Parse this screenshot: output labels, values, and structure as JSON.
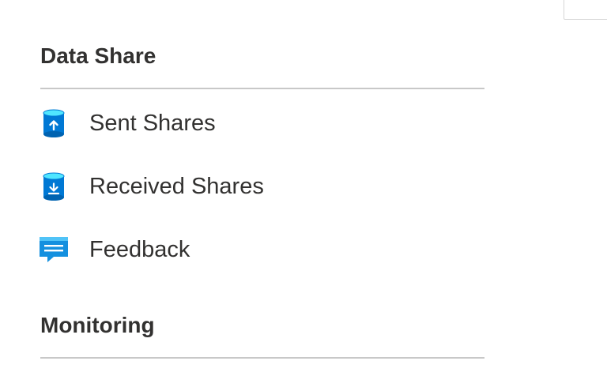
{
  "sections": [
    {
      "title": "Data Share",
      "items": [
        {
          "label": "Sent Shares",
          "icon": "sent-shares-icon"
        },
        {
          "label": "Received Shares",
          "icon": "received-shares-icon"
        },
        {
          "label": "Feedback",
          "icon": "feedback-icon"
        }
      ]
    },
    {
      "title": "Monitoring",
      "items": []
    }
  ],
  "colors": {
    "icon_blue": "#0078d4",
    "icon_light_blue": "#50e6ff",
    "feedback_blue": "#1490df",
    "divider": "#c8c8c8",
    "text": "#323130"
  }
}
